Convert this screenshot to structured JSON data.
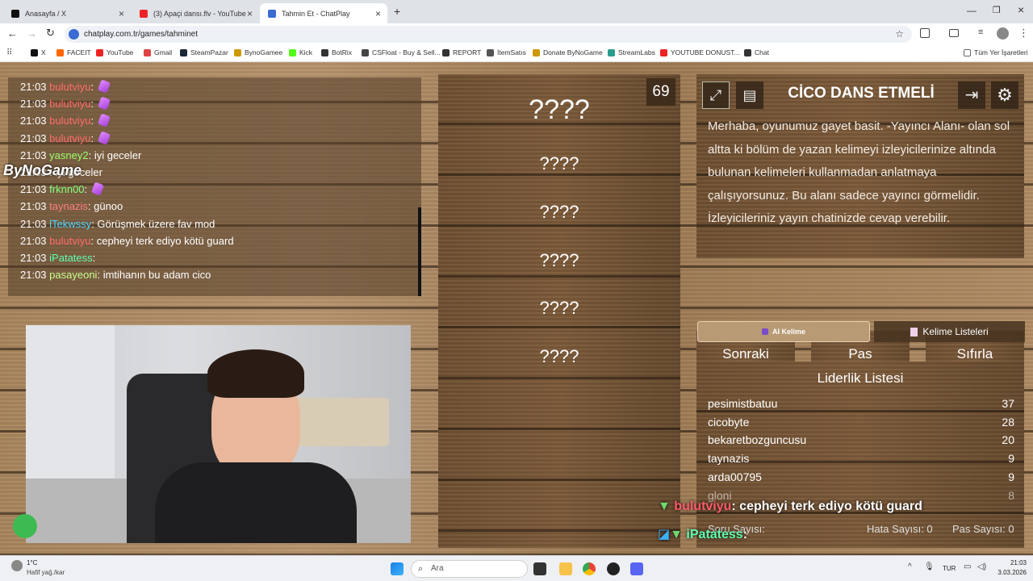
{
  "tabs": [
    {
      "title": "Anasayfa / X",
      "icon": "x-icon"
    },
    {
      "title": "(3) Apaçi dansı.flv - YouTube",
      "icon": "youtube-icon"
    },
    {
      "title": "Tahmin Et - ChatPlay",
      "icon": "chatplay-icon"
    }
  ],
  "address": {
    "url": "chatplay.com.tr/games/tahminet"
  },
  "bookmarks": [
    "X",
    "FACEIT",
    "YouTube",
    "Gmail",
    "SteamPazar",
    "BynoGamee",
    "Kick",
    "BotRix",
    "CSFloat - Buy & Sell...",
    "REPORT",
    "İtemSatıs",
    "Donate ByNoGame",
    "StreamLabs",
    "YOUTUBE DONUST...",
    "Chat"
  ],
  "bookmarks_all": "Tüm Yer İşaretleri",
  "chat": [
    {
      "time": "21:03",
      "user": "bulutviyu",
      "msg": "",
      "color": "#ff6b6b",
      "emote": true
    },
    {
      "time": "21:03",
      "user": "bulutviyu",
      "msg": "",
      "color": "#ff6b6b",
      "emote": true
    },
    {
      "time": "21:03",
      "user": "bulutviyu",
      "msg": "",
      "color": "#ff6b6b",
      "emote": true
    },
    {
      "time": "21:03",
      "user": "bulutviyu",
      "msg": "",
      "color": "#ff6b6b",
      "emote": true
    },
    {
      "time": "21:03",
      "user": "yasney2",
      "msg": "iyi geceler",
      "color": "#9cff6b",
      "emote": false
    },
    {
      "time": "21:03",
      "user": "",
      "msg": "iyi geceler",
      "color": "#ffffff",
      "emote": false
    },
    {
      "time": "21:03",
      "user": "frknn00",
      "msg": "",
      "color": "#7fff7f",
      "emote": true
    },
    {
      "time": "21:03",
      "user": "taynazis",
      "msg": "günoo",
      "color": "#ff7f7f",
      "emote": false
    },
    {
      "time": "21:03",
      "user": "lTekwssy",
      "msg": "Görüşmek üzere fav mod",
      "color": "#4fd6ff",
      "emote": false
    },
    {
      "time": "21:03",
      "user": "bulutviyu",
      "msg": "cepheyi terk ediyo kötü guard",
      "color": "#ff6b6b",
      "emote": false
    },
    {
      "time": "21:03",
      "user": "iPatatess",
      "msg": "",
      "color": "#5fffb0",
      "emote": false
    },
    {
      "time": "21:03",
      "user": "pasayeoni",
      "msg": "imtihanın bu adam cico",
      "color": "#c8ff8c",
      "emote": false
    }
  ],
  "watermark": "ByNoGame",
  "words": {
    "timer": "69",
    "items": [
      "????",
      "????",
      "????",
      "????",
      "????",
      "????"
    ]
  },
  "game": {
    "title": "CİCO DANS ETMELİ",
    "description": "Merhaba, oyunumuz gayet basit. -Yayıncı Alanı- olan sol altta ki bölüm de yazan kelimeyi izleyicilerinize altında bulunan kelimeleri kullanmadan anlatmaya çalışıyorsunuz. Bu alanı sadece yayıncı görmelidir. İzleyicileriniz yayın chatinizde cevap verebilir.",
    "buttons": [
      "Sonraki",
      "Pas",
      "Sıfırla"
    ],
    "ai_word": "AI Kelime",
    "word_lists": "Kelime Listeleri"
  },
  "leaderboard": {
    "title": "Liderlik Listesi",
    "rows": [
      {
        "name": "pesimistbatuu",
        "score": "37"
      },
      {
        "name": "cicobyte",
        "score": "28"
      },
      {
        "name": "bekaretbozguncusu",
        "score": "20"
      },
      {
        "name": "taynazis",
        "score": "9"
      },
      {
        "name": "arda00795",
        "score": "9"
      },
      {
        "name": "gloni",
        "score": "8"
      }
    ],
    "question_count": "Soru Sayısı:",
    "error_count": "Hata Sayısı: 0",
    "pass_count": "Pas Sayısı: 0"
  },
  "overlay": [
    {
      "user": "bulutviyu",
      "msg": ": cepheyi terk ediyo kötü guard"
    },
    {
      "user": "iPatatess",
      "msg": ":"
    }
  ],
  "taskbar": {
    "weather_temp": "1°C",
    "weather_desc": "Hafif yağ./kar",
    "search": "Ara",
    "lang": "TUR",
    "time": "21:03",
    "date": "3.03.2026"
  }
}
